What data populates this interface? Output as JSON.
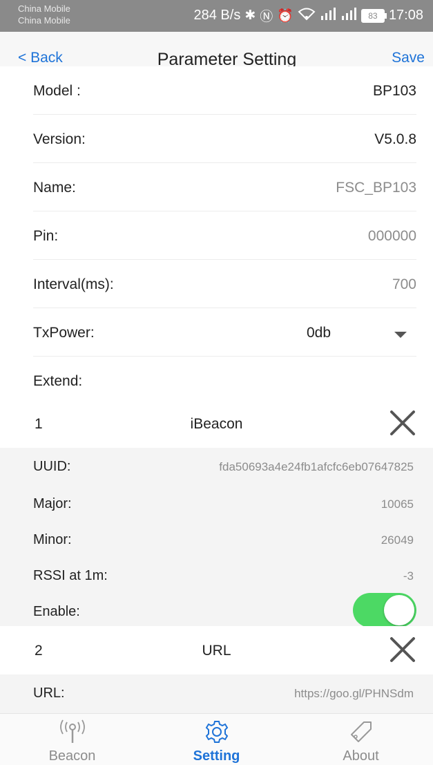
{
  "status_bar": {
    "carrier_1": "China Mobile",
    "carrier_2": "China Mobile",
    "speed": "284 B/s",
    "battery": "83",
    "time": "17:08"
  },
  "nav": {
    "back_label": "< Back",
    "title": "Parameter Setting",
    "save_label": "Save"
  },
  "fields": {
    "model": {
      "label": "Model :",
      "value": "BP103"
    },
    "version": {
      "label": "Version:",
      "value": "V5.0.8"
    },
    "name": {
      "label": "Name:",
      "value": "FSC_BP103"
    },
    "pin": {
      "label": "Pin:",
      "value": "000000"
    },
    "interval": {
      "label": "Interval(ms):",
      "value": "700"
    },
    "txpower": {
      "label": "TxPower:",
      "value": "0db"
    },
    "extend": {
      "label": "Extend:"
    }
  },
  "slot1": {
    "number": "1",
    "type": "iBeacon",
    "uuid": {
      "label": "UUID:",
      "value": "fda50693a4e24fb1afcfc6eb07647825"
    },
    "major": {
      "label": "Major:",
      "value": "10065"
    },
    "minor": {
      "label": "Minor:",
      "value": "26049"
    },
    "rssi": {
      "label": "RSSI at 1m:",
      "value": "-3"
    },
    "enable": {
      "label": "Enable:",
      "on": true
    }
  },
  "slot2": {
    "number": "2",
    "type": "URL",
    "url": {
      "label": "URL:",
      "value": "https://goo.gl/PHNSdm"
    }
  },
  "tabs": [
    {
      "label": "Beacon",
      "icon": "beacon-icon",
      "active": false
    },
    {
      "label": "Setting",
      "icon": "gear-icon",
      "active": true
    },
    {
      "label": "About",
      "icon": "tag-icon",
      "active": false
    }
  ],
  "colors": {
    "accent": "#1e73d8",
    "toggle_on": "#4cd964",
    "status_bar": "#8a8a8a"
  }
}
